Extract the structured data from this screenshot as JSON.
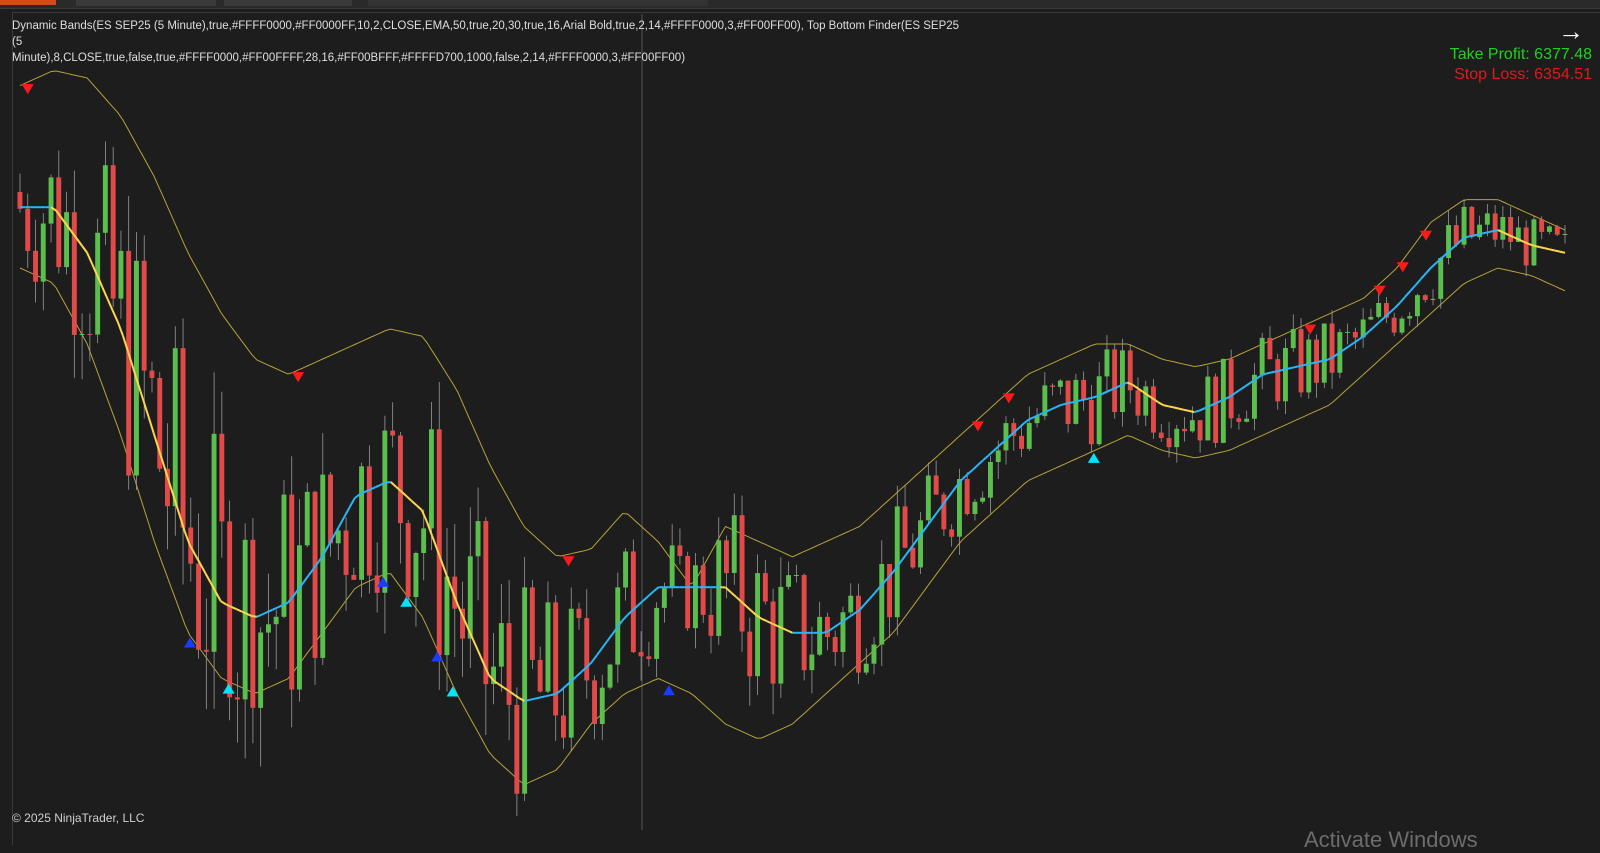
{
  "indicator_legend": {
    "line1": "Dynamic Bands(ES SEP25 (5 Minute),true,#FFFF0000,#FF0000FF,10,2,CLOSE,EMA,50,true,20,30,true,16,Arial Bold,true,2,14,#FFFF0000,3,#FF00FF00), Top Bottom Finder(ES SEP25 (5",
    "line2": "Minute),8,CLOSE,true,false,true,#FFFF0000,#FF00FFFF,28,16,#FF00BFFF,#FFFFD700,1000,false,2,14,#FFFF0000,3,#FF00FF00)"
  },
  "take_profit": "Take Profit: 6377.48",
  "stop_loss": "Stop Loss: 6354.51",
  "nav_icon": "arrow-right-icon",
  "copyright": "© 2025 NinjaTrader, LLC",
  "watermark": "Activate Windows",
  "colors": {
    "background": "#1d1d1d",
    "up_candle": "#5bbf4e",
    "down_candle": "#e24a4a",
    "band": "#b8a23a",
    "mid_bull": "#29b6f6",
    "mid_bear": "#ffd54f",
    "top_marker": "#ff1a1a",
    "bottom_marker": "#00e5ff",
    "bottom_marker_alt": "#1a3cff"
  },
  "chart_data": {
    "type": "candlestick",
    "instrument": "ES SEP25",
    "timeframe": "5 Minute",
    "approx_bars": 200,
    "y_range_approx": [
      6340,
      6385
    ],
    "series": [
      {
        "name": "mid",
        "values": [
          0.78,
          0.78,
          0.72,
          0.62,
          0.48,
          0.34,
          0.26,
          0.24,
          0.26,
          0.32,
          0.4,
          0.42,
          0.38,
          0.26,
          0.16,
          0.13,
          0.14,
          0.18,
          0.24,
          0.28,
          0.28,
          0.28,
          0.24,
          0.22,
          0.22,
          0.25,
          0.3,
          0.36,
          0.42,
          0.46,
          0.5,
          0.52,
          0.53,
          0.55,
          0.52,
          0.51,
          0.53,
          0.56,
          0.57,
          0.58,
          0.61,
          0.65,
          0.7,
          0.74,
          0.75,
          0.73,
          0.72
        ]
      },
      {
        "name": "upper",
        "values": [
          0.94,
          0.96,
          0.95,
          0.9,
          0.82,
          0.72,
          0.64,
          0.58,
          0.56,
          0.58,
          0.6,
          0.62,
          0.61,
          0.54,
          0.44,
          0.36,
          0.32,
          0.33,
          0.38,
          0.34,
          0.28,
          0.36,
          0.34,
          0.32,
          0.34,
          0.36,
          0.4,
          0.44,
          0.48,
          0.52,
          0.56,
          0.58,
          0.6,
          0.6,
          0.58,
          0.57,
          0.58,
          0.6,
          0.62,
          0.64,
          0.66,
          0.7,
          0.76,
          0.79,
          0.79,
          0.77,
          0.75
        ]
      },
      {
        "name": "lower",
        "values": [
          0.7,
          0.68,
          0.6,
          0.48,
          0.34,
          0.22,
          0.16,
          0.14,
          0.16,
          0.22,
          0.28,
          0.3,
          0.24,
          0.14,
          0.06,
          0.02,
          0.04,
          0.1,
          0.14,
          0.16,
          0.14,
          0.1,
          0.08,
          0.1,
          0.14,
          0.18,
          0.22,
          0.28,
          0.34,
          0.38,
          0.42,
          0.44,
          0.46,
          0.48,
          0.46,
          0.45,
          0.46,
          0.48,
          0.5,
          0.52,
          0.56,
          0.6,
          0.64,
          0.68,
          0.7,
          0.69,
          0.67
        ]
      }
    ],
    "top_markers": [
      0.005,
      0.18,
      0.355,
      0.62,
      0.64,
      0.835,
      0.88,
      0.895,
      0.91
    ],
    "bottom_markers": [
      0.11,
      0.135,
      0.235,
      0.25,
      0.27,
      0.28,
      0.42,
      0.695
    ]
  }
}
